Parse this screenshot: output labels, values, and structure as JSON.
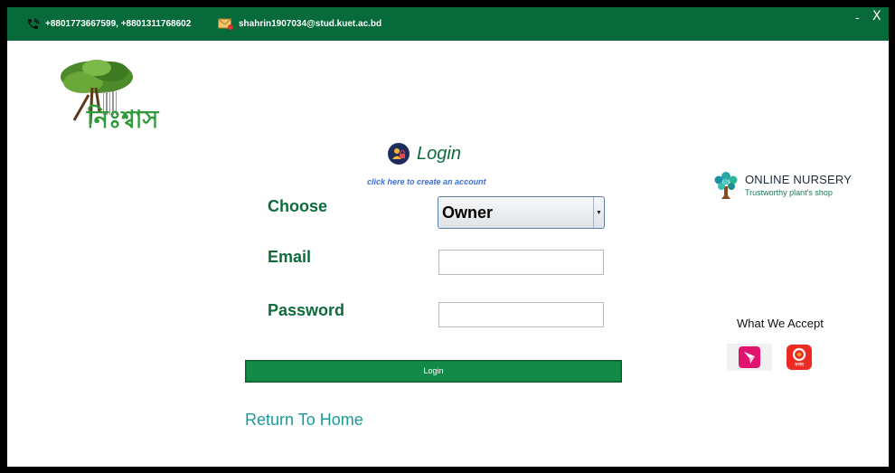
{
  "topbar": {
    "phone": "+8801773667599, +8801311768602",
    "email": "shahrin1907034@stud.kuet.ac.bd",
    "minimize": "-",
    "close": "X"
  },
  "logo": {
    "text": "নিঃশ্বাস"
  },
  "login": {
    "title": "Login",
    "create_account": "click here to create an account",
    "choose_label": "Choose",
    "choose_value": "Owner",
    "email_label": "Email",
    "email_value": "",
    "password_label": "Password",
    "password_value": "",
    "button": "Login",
    "return_home": "Return To Home"
  },
  "brand": {
    "name": "ONLINE NURSERY",
    "tagline": "Trustworthy plant's shop"
  },
  "payments": {
    "title": "What We Accept",
    "methods": [
      "bkash-icon",
      "nagad-icon"
    ],
    "nagad_label": "নগদ"
  },
  "colors": {
    "topbar": "#076a3a",
    "accent_green": "#0e6b3a",
    "button": "#138a45",
    "link": "#1c9a9a",
    "create_link": "#3a6fd8"
  }
}
